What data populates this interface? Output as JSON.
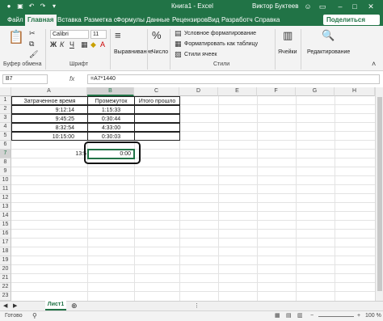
{
  "window": {
    "title": "Книга1 - Excel",
    "user": "Виктор Буктеев"
  },
  "tabs": [
    "Файл",
    "Главная",
    "Вставка",
    "Разметка с",
    "Формулы",
    "Данные",
    "Рецензиров",
    "Вид",
    "Разработч",
    "Справка"
  ],
  "share_label": "Поделиться",
  "ribbon": {
    "font_name": "Calibri",
    "font_size": "11",
    "groups": {
      "clipboard": "Буфер обмена",
      "font": "Шрифт",
      "styles": "Стили",
      "number": "Число",
      "alignment": "Выравнивание",
      "cells": "Ячейки",
      "editing": "Редактирование"
    },
    "style_items": [
      "Условное форматирование",
      "Форматировать как таблицу",
      "Стили ячеек"
    ],
    "number_label": "Число",
    "cells_label": "Ячейки",
    "editing_label": "Редактирование"
  },
  "formula_bar": {
    "namebox": "B7",
    "fx": "fx",
    "formula": "=A7*1440"
  },
  "columns": [
    "A",
    "B",
    "C",
    "D",
    "E",
    "F",
    "G",
    "H"
  ],
  "rows": [
    "1",
    "2",
    "3",
    "4",
    "5",
    "6",
    "7",
    "8",
    "9",
    "10",
    "11",
    "12",
    "13",
    "14",
    "15",
    "16",
    "17",
    "18",
    "19",
    "20",
    "21",
    "22",
    "23"
  ],
  "cells": {
    "A1": "Затраченное время",
    "B1": "Промежуток",
    "C1": "Итого прошло",
    "A2": "9:12:14",
    "B2": "1:15:33",
    "A3": "9:45:25",
    "B3": "0:30:44",
    "A4": "8:32:54",
    "B4": "4:33:00",
    "A5": "10:15:00",
    "B5": "0:30:03",
    "A7": "13:5",
    "B7": "0:00"
  },
  "sheet_tab": "Лист1",
  "status": {
    "ready": "Готово",
    "zoom": "100 %"
  },
  "colors": {
    "accent": "#217346"
  }
}
